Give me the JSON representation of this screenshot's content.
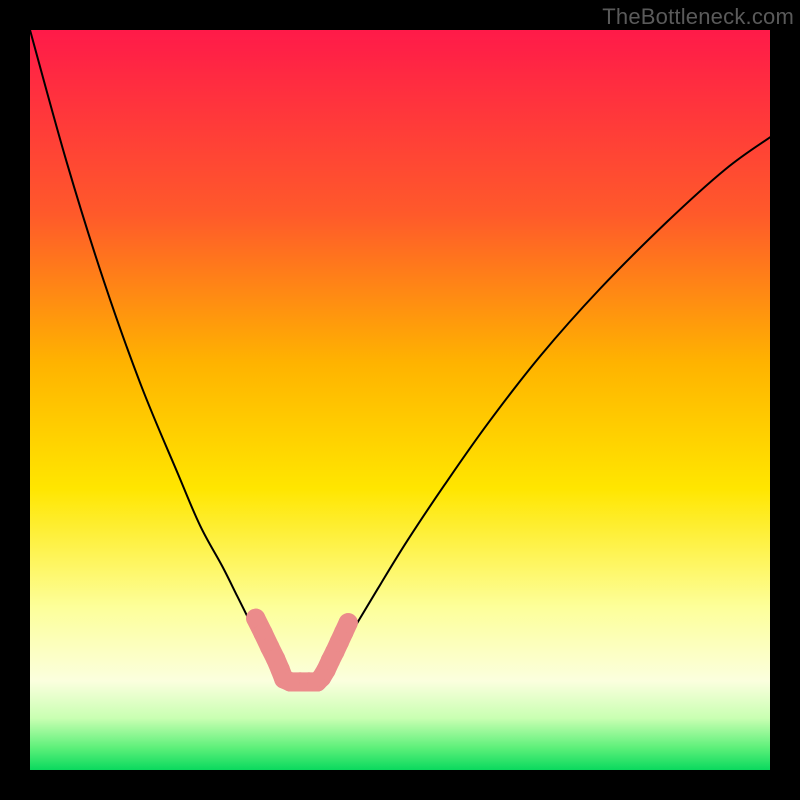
{
  "attribution": "TheBottleneck.com",
  "chart_data": {
    "type": "line",
    "title": "",
    "xlabel": "",
    "ylabel": "",
    "xlim": [
      0,
      1
    ],
    "ylim": [
      0,
      1
    ],
    "gradient_stops": [
      {
        "offset": 0.0,
        "color": "#ff1a49"
      },
      {
        "offset": 0.25,
        "color": "#ff5a2a"
      },
      {
        "offset": 0.45,
        "color": "#ffb300"
      },
      {
        "offset": 0.62,
        "color": "#ffe600"
      },
      {
        "offset": 0.78,
        "color": "#fdff9a"
      },
      {
        "offset": 0.88,
        "color": "#fbffde"
      },
      {
        "offset": 0.93,
        "color": "#c9ffb2"
      },
      {
        "offset": 0.97,
        "color": "#5df07a"
      },
      {
        "offset": 1.0,
        "color": "#0ad95e"
      }
    ],
    "floor_y": 0.127,
    "series": [
      {
        "name": "left-branch",
        "x": [
          0.0,
          0.05,
          0.1,
          0.15,
          0.2,
          0.23,
          0.26,
          0.28,
          0.295,
          0.31,
          0.325,
          0.335,
          0.34
        ],
        "values": [
          1.0,
          0.82,
          0.66,
          0.52,
          0.4,
          0.33,
          0.275,
          0.235,
          0.205,
          0.175,
          0.15,
          0.135,
          0.125
        ]
      },
      {
        "name": "right-branch",
        "x": [
          0.395,
          0.405,
          0.42,
          0.44,
          0.47,
          0.51,
          0.56,
          0.62,
          0.69,
          0.77,
          0.86,
          0.94,
          1.0
        ],
        "values": [
          0.125,
          0.135,
          0.16,
          0.195,
          0.245,
          0.31,
          0.385,
          0.47,
          0.56,
          0.65,
          0.74,
          0.812,
          0.855
        ]
      },
      {
        "name": "floor-segment",
        "x": [
          0.34,
          0.395
        ],
        "values": [
          0.125,
          0.125
        ]
      }
    ],
    "marker_series": [
      {
        "name": "marker-cluster",
        "color": "#eb8b8b",
        "radius_frac": 0.013,
        "points": [
          {
            "x": 0.305,
            "y": 0.205
          },
          {
            "x": 0.315,
            "y": 0.185
          },
          {
            "x": 0.324,
            "y": 0.166
          },
          {
            "x": 0.332,
            "y": 0.15
          },
          {
            "x": 0.338,
            "y": 0.136
          },
          {
            "x": 0.343,
            "y": 0.123
          },
          {
            "x": 0.352,
            "y": 0.119
          },
          {
            "x": 0.365,
            "y": 0.119
          },
          {
            "x": 0.377,
            "y": 0.119
          },
          {
            "x": 0.388,
            "y": 0.119
          },
          {
            "x": 0.394,
            "y": 0.125
          },
          {
            "x": 0.4,
            "y": 0.135
          },
          {
            "x": 0.406,
            "y": 0.148
          },
          {
            "x": 0.412,
            "y": 0.16
          },
          {
            "x": 0.418,
            "y": 0.173
          },
          {
            "x": 0.424,
            "y": 0.186
          },
          {
            "x": 0.43,
            "y": 0.199
          }
        ]
      }
    ]
  }
}
